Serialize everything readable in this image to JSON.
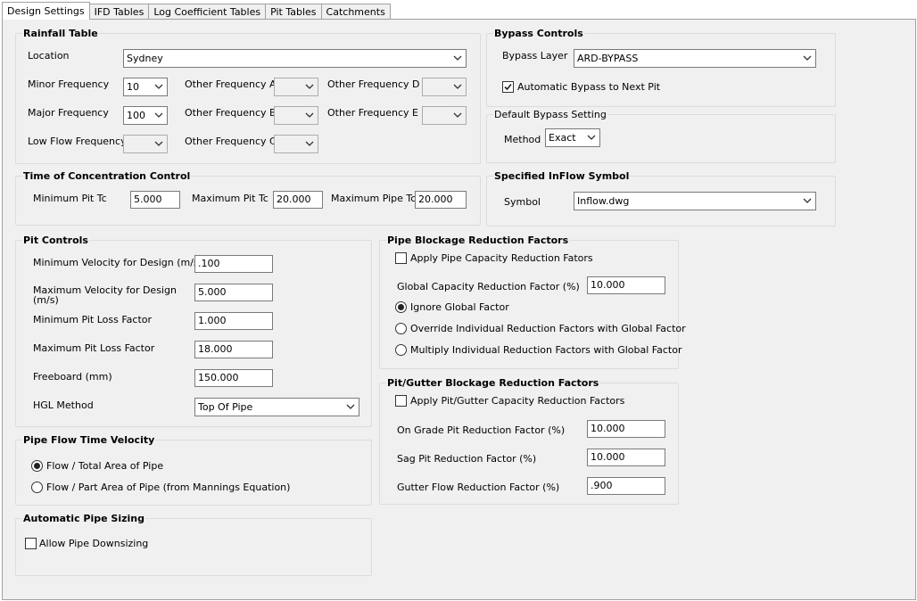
{
  "tabs": [
    "Design Settings",
    "IFD Tables",
    "Log Coefficient Tables",
    "Pit Tables",
    "Catchments"
  ],
  "rainfall": {
    "title": "Rainfall Table",
    "location_label": "Location",
    "location_value": "Sydney",
    "minor_label": "Minor Frequency",
    "minor_value": "10",
    "major_label": "Major Frequency",
    "major_value": "100",
    "lowflow_label": "Low Flow Frequency",
    "lowflow_value": "",
    "other_a_label": "Other Frequency A",
    "other_b_label": "Other Frequency B",
    "other_c_label": "Other Frequency C",
    "other_d_label": "Other Frequency D",
    "other_e_label": "Other Frequency E"
  },
  "bypass": {
    "title": "Bypass Controls",
    "layer_label": "Bypass Layer",
    "layer_value": "ARD-BYPASS",
    "auto_label": "Automatic Bypass to Next Pit",
    "auto_checked": true
  },
  "default_bypass": {
    "title": "Default Bypass Setting",
    "method_label": "Method",
    "method_value": "Exact"
  },
  "toc": {
    "title": "Time of Concentration Control",
    "min_pit_label": "Minimum Pit Tc",
    "min_pit_value": "5.000",
    "max_pit_label": "Maximum Pit Tc",
    "max_pit_value": "20.000",
    "max_pipe_label": "Maximum Pipe Tc",
    "max_pipe_value": "20.000"
  },
  "inflow": {
    "title": "Specified InFlow Symbol",
    "symbol_label": "Symbol",
    "symbol_value": "Inflow.dwg"
  },
  "pit_controls": {
    "title": "Pit Controls",
    "min_vel_label": "Minimum Velocity for Design (m/s)",
    "min_vel_value": ".100",
    "max_vel_label": "Maximum Velocity for Design (m/s)",
    "max_vel_value": "5.000",
    "min_loss_label": "Minimum Pit Loss Factor",
    "min_loss_value": "1.000",
    "max_loss_label": "Maximum Pit Loss Factor",
    "max_loss_value": "18.000",
    "freeboard_label": "Freeboard (mm)",
    "freeboard_value": "150.000",
    "hgl_label": "HGL Method",
    "hgl_value": "Top Of Pipe"
  },
  "pipe_flow": {
    "title": "Pipe Flow Time Velocity",
    "option1": "Flow / Total Area of Pipe",
    "option2": "Flow / Part Area of Pipe (from Mannings Equation)"
  },
  "auto_sizing": {
    "title": "Automatic Pipe Sizing",
    "downsizing_label": "Allow Pipe Downsizing"
  },
  "pipe_blockage": {
    "title": "Pipe Blockage Reduction Factors",
    "apply_label": "Apply Pipe Capacity Reduction Fators",
    "global_label": "Global Capacity Reduction Factor (%)",
    "global_value": "10.000",
    "radio1": "Ignore Global Factor",
    "radio2": "Override Individual Reduction Factors with Global Factor",
    "radio3": "Multiply Individual Reduction Factors with Global Factor"
  },
  "pit_blockage": {
    "title": "Pit/Gutter Blockage Reduction Factors",
    "apply_label": "Apply Pit/Gutter Capacity Reduction Factors",
    "ongrade_label": "On Grade Pit Reduction Factor (%)",
    "ongrade_value": "10.000",
    "sag_label": "Sag Pit Reduction Factor (%)",
    "sag_value": "10.000",
    "gutter_label": "Gutter Flow Reduction Factor (%)",
    "gutter_value": ".900"
  }
}
